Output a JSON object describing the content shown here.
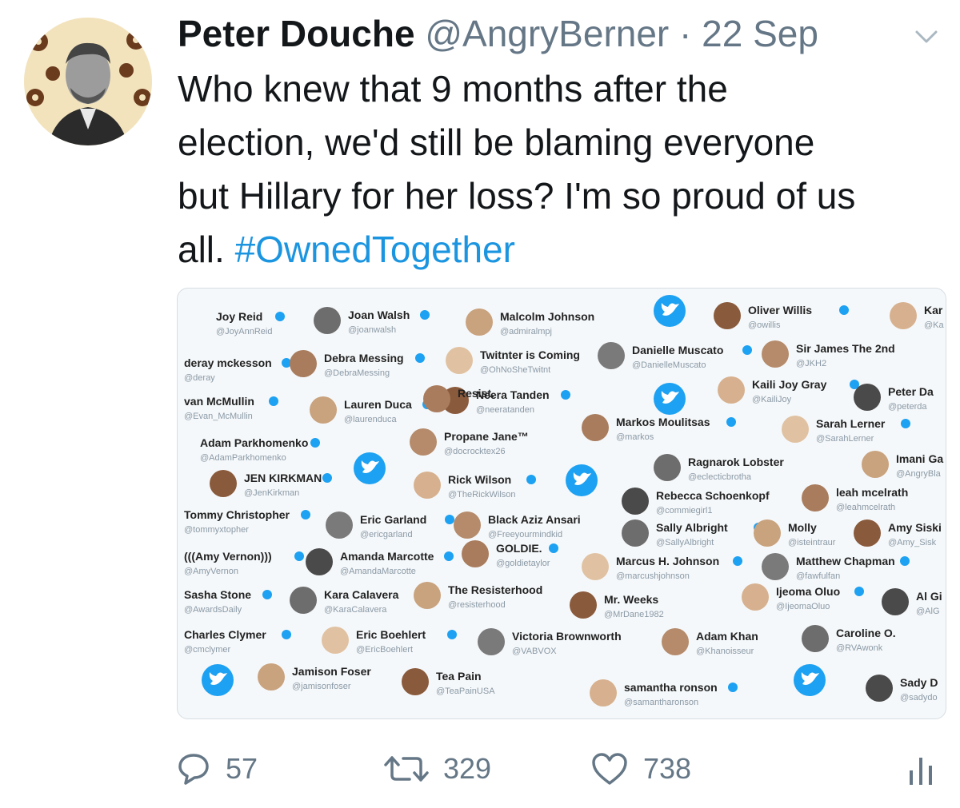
{
  "tweet": {
    "author_name": "Peter Douche",
    "author_handle": "@AngryBerner",
    "separator": "·",
    "date": "22 Sep",
    "text_lines": [
      "Who knew that 9 months after the",
      "election, we'd still be blaming everyone",
      "but Hillary for her loss? I'm so proud of us",
      "all."
    ],
    "hashtag": "#OwnedTogether"
  },
  "media": {
    "accounts": [
      {
        "name": "Joy Reid",
        "handle": "@JoyAnnReid",
        "verified": true
      },
      {
        "name": "Joan Walsh",
        "handle": "@joanwalsh",
        "verified": true
      },
      {
        "name": "Malcolm Johnson",
        "handle": "@admiralmpj",
        "verified": false
      },
      {
        "name": "Oliver Willis",
        "handle": "@owillis",
        "verified": true
      },
      {
        "name": "Kar",
        "handle": "@Ka",
        "verified": false
      },
      {
        "name": "deray mckesson",
        "handle": "@deray",
        "verified": true
      },
      {
        "name": "Debra Messing",
        "handle": "@DebraMessing",
        "verified": true
      },
      {
        "name": "Twitnter is Coming",
        "handle": "@OhNoSheTwitnt",
        "verified": false
      },
      {
        "name": "Danielle Muscato",
        "handle": "@DanielleMuscato",
        "verified": true
      },
      {
        "name": "Sir James The 2nd",
        "handle": "@JKH2",
        "verified": false
      },
      {
        "name": "van McMullin",
        "handle": "@Evan_McMullin",
        "verified": true
      },
      {
        "name": "Lauren Duca",
        "handle": "@laurenduca",
        "verified": true
      },
      {
        "name": "Neera Tanden",
        "handle": "@neeratanden",
        "verified": true
      },
      {
        "name": "Kaili Joy Gray",
        "handle": "@KailiJoy",
        "verified": true
      },
      {
        "name": "Peter Da",
        "handle": "@peterda",
        "verified": false
      },
      {
        "name": "Markos Moulitsas",
        "handle": "@markos",
        "verified": true
      },
      {
        "name": "Sarah Lerner",
        "handle": "@SarahLerner",
        "verified": true
      },
      {
        "name": "Adam Parkhomenko",
        "handle": "@AdamParkhomenko",
        "verified": true
      },
      {
        "name": "Propane Jane™",
        "handle": "@docrocktex26",
        "verified": false
      },
      {
        "name": "Ragnarok Lobster",
        "handle": "@eclecticbrotha",
        "verified": false
      },
      {
        "name": "Imani Ga",
        "handle": "@AngryBla",
        "verified": false
      },
      {
        "name": "JEN KIRKMAN",
        "handle": "@JenKirkman",
        "verified": true
      },
      {
        "name": "Rick Wilson",
        "handle": "@TheRickWilson",
        "verified": true
      },
      {
        "name": "Rebecca Schoenkopf",
        "handle": "@commiegirl1",
        "verified": false
      },
      {
        "name": "leah mcelrath",
        "handle": "@leahmcelrath",
        "verified": false
      },
      {
        "name": "Tommy Christopher",
        "handle": "@tommyxtopher",
        "verified": true
      },
      {
        "name": "Eric Garland",
        "handle": "@ericgarland",
        "verified": true
      },
      {
        "name": "Black Aziz Ansari",
        "handle": "@Freeyourmindkid",
        "verified": false
      },
      {
        "name": "Sally Albright",
        "handle": "@SallyAlbright",
        "verified": true
      },
      {
        "name": "Molly",
        "handle": "@isteintraur",
        "verified": false
      },
      {
        "name": "Amy Siski",
        "handle": "@Amy_Sisk",
        "verified": false
      },
      {
        "name": "(((Amy Vernon)))",
        "handle": "@AmyVernon",
        "verified": true
      },
      {
        "name": "Amanda Marcotte",
        "handle": "@AmandaMarcotte",
        "verified": true
      },
      {
        "name": "GOLDIE.",
        "handle": "@goldietaylor",
        "verified": true
      },
      {
        "name": "Marcus H. Johnson",
        "handle": "@marcushjohnson",
        "verified": true
      },
      {
        "name": "Matthew Chapman",
        "handle": "@fawfulfan",
        "verified": true
      },
      {
        "name": "Sasha Stone",
        "handle": "@AwardsDaily",
        "verified": true
      },
      {
        "name": "Kara Calavera",
        "handle": "@KaraCalavera",
        "verified": false
      },
      {
        "name": "The Resisterhood",
        "handle": "@resisterhood",
        "verified": false
      },
      {
        "name": "Mr. Weeks",
        "handle": "@MrDane1982",
        "verified": false
      },
      {
        "name": "Ijeoma Oluo",
        "handle": "@IjeomaOluo",
        "verified": true
      },
      {
        "name": "Al Gi",
        "handle": "@AlG",
        "verified": false
      },
      {
        "name": "Charles Clymer",
        "handle": "@cmclymer",
        "verified": true
      },
      {
        "name": "Eric Boehlert",
        "handle": "@EricBoehlert",
        "verified": true
      },
      {
        "name": "Victoria Brownworth",
        "handle": "@VABVOX",
        "verified": false
      },
      {
        "name": "Adam Khan",
        "handle": "@Khanoisseur",
        "verified": false
      },
      {
        "name": "Caroline O.",
        "handle": "@RVAwonk",
        "verified": false
      },
      {
        "name": "Jamison Foser",
        "handle": "@jamisonfoser",
        "verified": false
      },
      {
        "name": "Tea Pain",
        "handle": "@TeaPainUSA",
        "verified": false
      },
      {
        "name": "samantha ronson",
        "handle": "@samantharonson",
        "verified": true
      },
      {
        "name": "Sady D",
        "handle": "@sadydo",
        "verified": false
      },
      {
        "name": "Resist.",
        "handle": "",
        "verified": false
      }
    ]
  },
  "actions": {
    "replies": "57",
    "retweets": "329",
    "likes": "738"
  },
  "icons": {
    "reply": "reply-icon",
    "retweet": "retweet-icon",
    "like": "heart-icon",
    "stats": "analytics-icon",
    "menu": "chevron-down-icon",
    "twitter": "twitter-bird-icon",
    "verified": "verified-badge-icon"
  },
  "colors": {
    "accent": "#1b95e0",
    "text": "#14171a",
    "secondary": "#657786",
    "verified": "#1da1f2"
  }
}
